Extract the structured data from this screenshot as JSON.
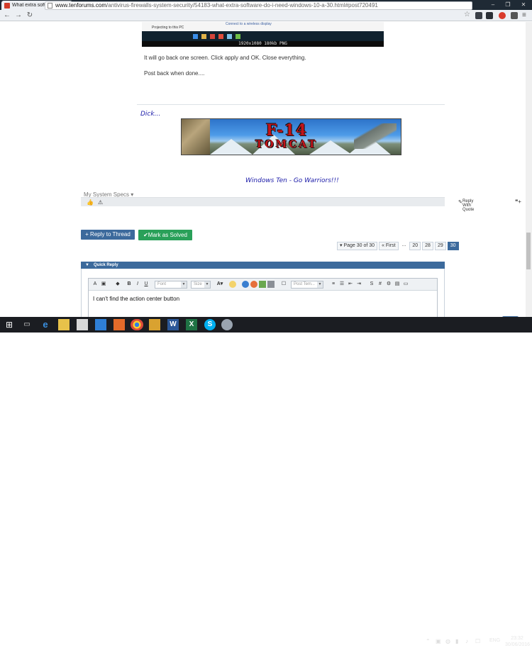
{
  "browser": {
    "tab_title": "What extra software do I",
    "tab_close": "×",
    "url_host": "www.tenforums.com",
    "url_path": "/antivirus-firewalls-system-security/54183-what-extra-software-do-i-need-windows-10-a-30.html#post720491",
    "window_controls": [
      "–",
      "❐",
      "✕"
    ],
    "user_badge": "",
    "nav_icons": [
      "back-arrow",
      "forward-arrow",
      "reload"
    ]
  },
  "post": {
    "thumb_caption": "Projecting to this PC",
    "thumb_link": "Connect to a wireless display",
    "thumb_footer": "1920x1080 180kb PNG",
    "line1": "It will go back one screen. Click apply and OK. Close everything.",
    "line2": "Post back when done....",
    "sig_name": "Dick...",
    "banner_logo_top": "F-14",
    "banner_logo_sub": "TOMCAT",
    "sig_tagline": "Windows Ten - Go Warriors!!!",
    "system_specs": "My System Specs",
    "reply_with_quote": "Reply With Quote"
  },
  "actions": {
    "reply_to_thread": "+ Reply to Thread",
    "mark_solved": "Mark as Solved"
  },
  "pager": {
    "label": "Page 30 of 30",
    "first": "First",
    "ellipsis": "...",
    "pages": [
      "20",
      "28",
      "29",
      "30"
    ],
    "current": "30"
  },
  "quick_reply": {
    "title": "Quick Reply",
    "font_placeholder": "Font",
    "size_placeholder": "Size",
    "template_placeholder": "Post Tem...",
    "text": "I can't find the action center button"
  },
  "taskbar": {
    "language": "ENG",
    "time": "23:32",
    "date": "30/06/2016"
  },
  "colors": {
    "accent": "#3c6a9c",
    "solved": "#29a059",
    "signature": "#1a1aa8"
  }
}
